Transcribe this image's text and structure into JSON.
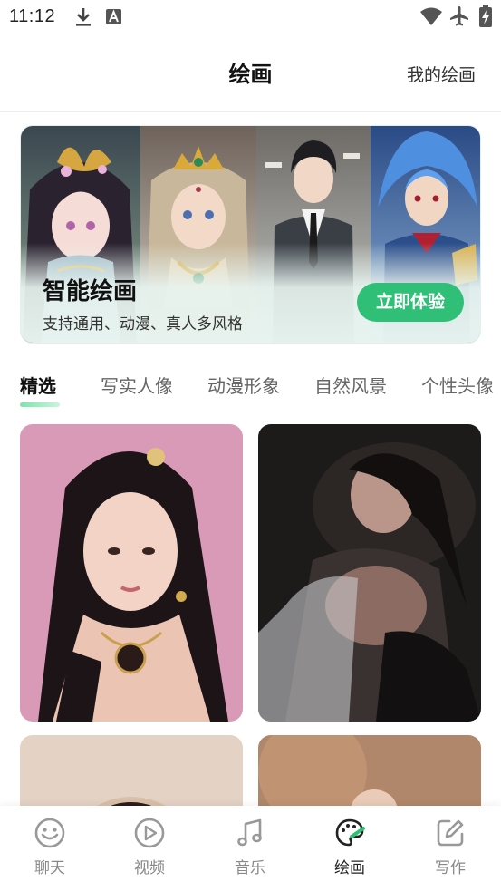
{
  "status_bar": {
    "time": "11:12",
    "left_icons": [
      "download-icon",
      "a-notification-icon"
    ],
    "right_icons": [
      "wifi-icon",
      "airplane-icon",
      "battery-charging-icon"
    ]
  },
  "header": {
    "title": "绘画",
    "right_link": "我的绘画"
  },
  "banner": {
    "title": "智能绘画",
    "subtitle": "支持通用、动漫、真人多风格",
    "button": "立即体验"
  },
  "tabs": [
    {
      "label": "精选",
      "active": true
    },
    {
      "label": "写实人像",
      "active": false
    },
    {
      "label": "动漫形象",
      "active": false
    },
    {
      "label": "自然风景",
      "active": false
    },
    {
      "label": "个性头像",
      "active": false
    }
  ],
  "bottom_nav": [
    {
      "label": "聊天",
      "icon": "smile-icon",
      "active": false
    },
    {
      "label": "视频",
      "icon": "play-icon",
      "active": false
    },
    {
      "label": "音乐",
      "icon": "music-note-icon",
      "active": false
    },
    {
      "label": "绘画",
      "icon": "palette-icon",
      "active": true
    },
    {
      "label": "写作",
      "icon": "edit-icon",
      "active": false
    }
  ],
  "colors": {
    "accent": "#2fbf77",
    "tab_indicator": "#7de3ac",
    "inactive": "#888888"
  }
}
